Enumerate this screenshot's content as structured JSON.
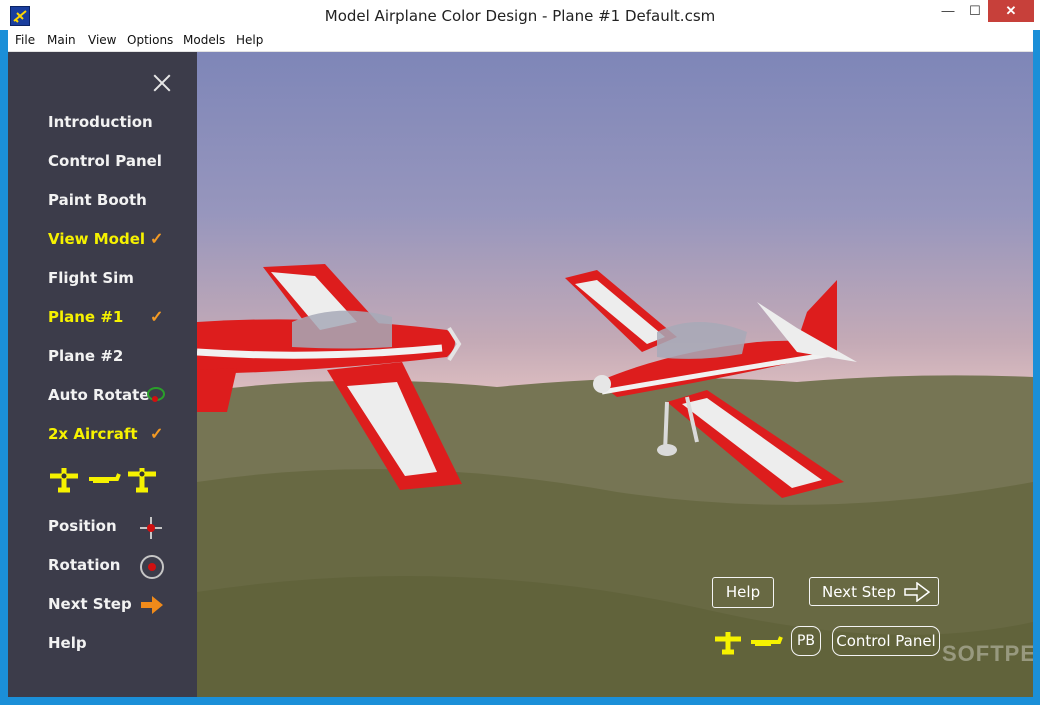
{
  "window": {
    "title": "Model Airplane Color Design - Plane #1  Default.csm",
    "min": "—",
    "max": "☐",
    "close": "✕"
  },
  "menu": [
    "File",
    "Main",
    "View",
    "Options",
    "Models",
    "Help"
  ],
  "sidebar": {
    "items": [
      {
        "label": "Introduction"
      },
      {
        "label": "Control Panel"
      },
      {
        "label": "Paint Booth"
      },
      {
        "label": "View Model",
        "checked": "✓"
      },
      {
        "label": "Flight Sim"
      },
      {
        "label": "Plane #1",
        "checked": "✓"
      },
      {
        "label": "Plane #2"
      },
      {
        "label": "Auto Rotate"
      },
      {
        "label": "2x Aircraft",
        "checked": "✓"
      },
      {
        "label": "Position"
      },
      {
        "label": "Rotation"
      },
      {
        "label": "Next Step"
      },
      {
        "label": "Help"
      }
    ]
  },
  "overlay": {
    "help": "Help",
    "next_step": "Next Step",
    "pb": "PB",
    "control_panel": "Control Panel",
    "watermark": "SOFTPEDIA"
  },
  "colors": {
    "accent_yellow": "#f6f200",
    "check_orange": "#f39a24",
    "sidebar_bg": "#3c3c4a",
    "plane_red": "#dd1d1d"
  }
}
